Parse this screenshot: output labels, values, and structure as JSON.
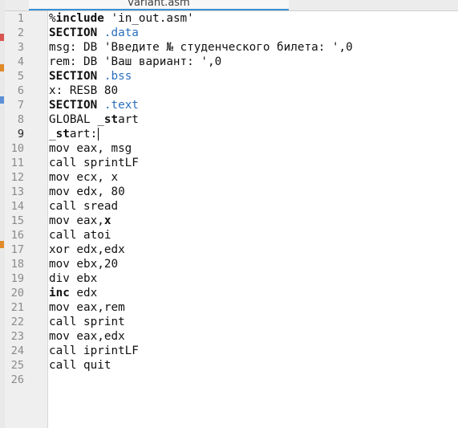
{
  "tab": {
    "title": "variant.asm"
  },
  "current_line": 9,
  "colors": {
    "accent": "#3d8fd1",
    "section_name": "#2a6fbf"
  },
  "lines": [
    {
      "num": "1",
      "parts": [
        {
          "t": "%"
        },
        {
          "t": "include",
          "k": "kw"
        },
        {
          "t": " 'in_out.asm'"
        }
      ]
    },
    {
      "num": "2",
      "parts": [
        {
          "t": "SECTION",
          "k": "kw"
        },
        {
          "t": " "
        },
        {
          "t": ".data",
          "k": "sect"
        }
      ]
    },
    {
      "num": "3",
      "parts": [
        {
          "t": "msg: DB 'Введите № студенческого билета: ',0"
        }
      ]
    },
    {
      "num": "4",
      "parts": [
        {
          "t": "rem: DB 'Ваш вариант: ',0"
        }
      ]
    },
    {
      "num": "5",
      "parts": [
        {
          "t": "SECTION",
          "k": "kw"
        },
        {
          "t": " "
        },
        {
          "t": ".bss",
          "k": "sect"
        }
      ]
    },
    {
      "num": "6",
      "parts": [
        {
          "t": "x: RESB 80"
        }
      ]
    },
    {
      "num": "7",
      "parts": [
        {
          "t": "SECTION",
          "k": "kw"
        },
        {
          "t": " "
        },
        {
          "t": ".text",
          "k": "sect"
        }
      ]
    },
    {
      "num": "8",
      "parts": [
        {
          "t": "GLOBAL _"
        },
        {
          "t": "st",
          "k": "kw"
        },
        {
          "t": "art"
        }
      ]
    },
    {
      "num": "9",
      "parts": [
        {
          "t": "_"
        },
        {
          "t": "st",
          "k": "kw"
        },
        {
          "t": "art:"
        }
      ]
    },
    {
      "num": "10",
      "parts": [
        {
          "t": "mov eax, msg"
        }
      ]
    },
    {
      "num": "11",
      "parts": [
        {
          "t": "call sprintLF"
        }
      ]
    },
    {
      "num": "12",
      "parts": [
        {
          "t": "mov ecx, x"
        }
      ]
    },
    {
      "num": "13",
      "parts": [
        {
          "t": "mov edx, 80"
        }
      ]
    },
    {
      "num": "14",
      "parts": [
        {
          "t": "call sread"
        }
      ]
    },
    {
      "num": "15",
      "parts": [
        {
          "t": "mov eax,"
        },
        {
          "t": "x",
          "k": "kw"
        }
      ]
    },
    {
      "num": "16",
      "parts": [
        {
          "t": "call atoi"
        }
      ]
    },
    {
      "num": "17",
      "parts": [
        {
          "t": "xor edx,edx"
        }
      ]
    },
    {
      "num": "18",
      "parts": [
        {
          "t": "mov ebx,20"
        }
      ]
    },
    {
      "num": "19",
      "parts": [
        {
          "t": "div ebx"
        }
      ]
    },
    {
      "num": "20",
      "parts": [
        {
          "t": "inc",
          "k": "kw"
        },
        {
          "t": " edx"
        }
      ]
    },
    {
      "num": "21",
      "parts": [
        {
          "t": "mov eax,rem"
        }
      ]
    },
    {
      "num": "22",
      "parts": [
        {
          "t": "call sprint"
        }
      ]
    },
    {
      "num": "23",
      "parts": [
        {
          "t": "mov eax,edx"
        }
      ]
    },
    {
      "num": "24",
      "parts": [
        {
          "t": "call iprintLF"
        }
      ]
    },
    {
      "num": "25",
      "parts": [
        {
          "t": "call quit"
        }
      ]
    },
    {
      "num": "26",
      "parts": []
    }
  ]
}
